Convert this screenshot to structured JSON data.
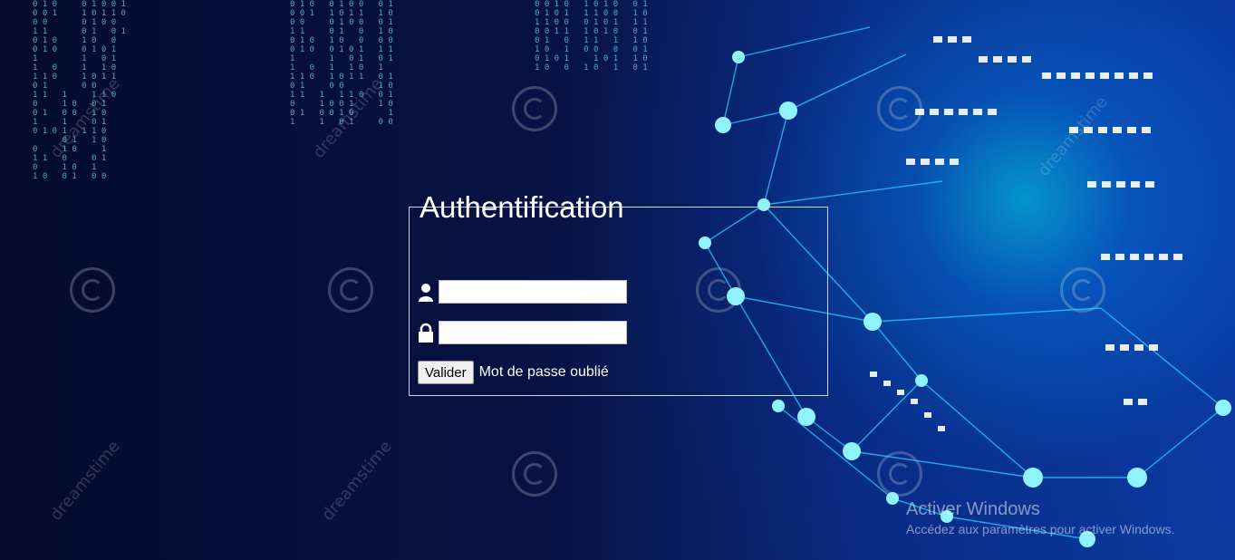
{
  "form": {
    "legend": "Authentification",
    "username": {
      "value": "",
      "placeholder": ""
    },
    "password": {
      "value": "",
      "placeholder": ""
    },
    "submit_label": "Valider",
    "forgot_link": "Mot de passe oublié"
  },
  "icons": {
    "username": "user-icon",
    "password": "lock-icon"
  },
  "windows_activation": {
    "title": "Activer Windows",
    "subtitle": "Accédez aux paramètres pour activer Windows."
  },
  "watermark": "dreamstime",
  "colors": {
    "accent": "#00e6ff",
    "background": "#071345"
  }
}
